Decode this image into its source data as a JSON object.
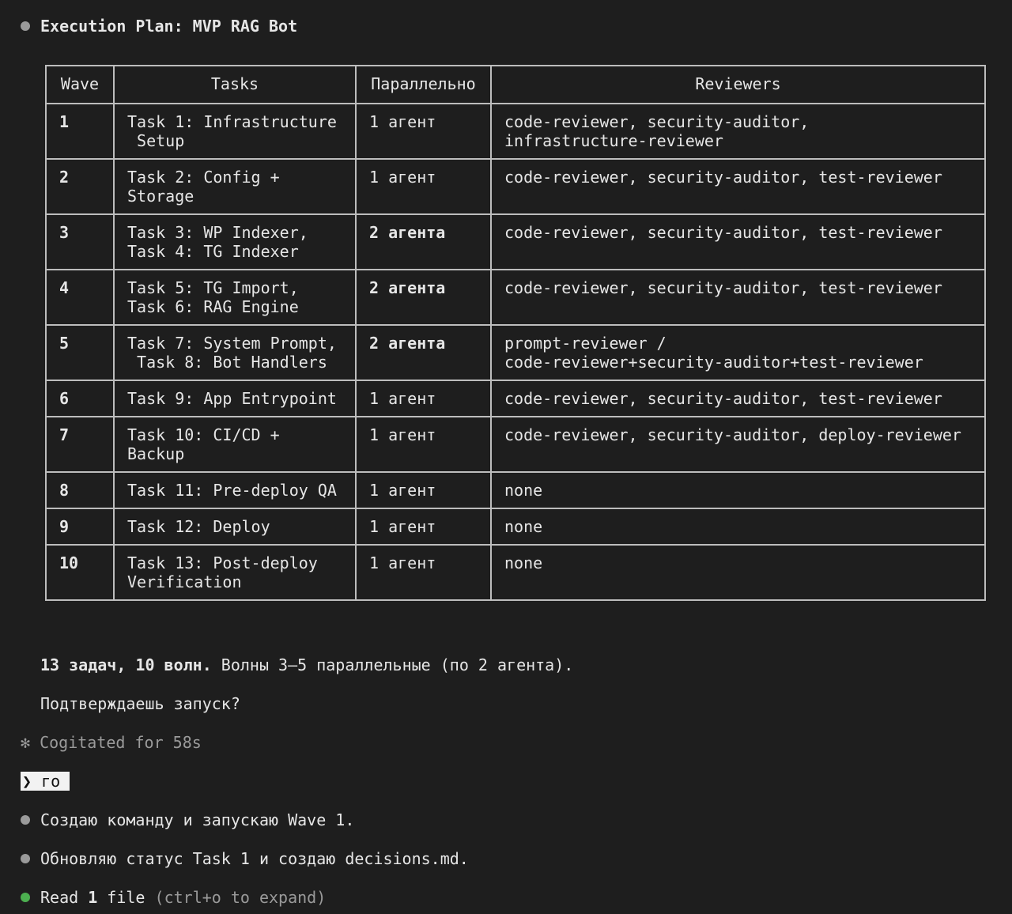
{
  "header": {
    "title": "Execution Plan: MVP RAG Bot"
  },
  "table": {
    "columns": [
      "Wave",
      "Tasks",
      "Параллельно",
      "Reviewers"
    ],
    "rows": [
      {
        "wave": "1",
        "tasks": "Task 1: Infrastructure\n Setup",
        "parallel": "1 агент",
        "reviewers": "code-reviewer, security-auditor,\ninfrastructure-reviewer"
      },
      {
        "wave": "2",
        "tasks": "Task 2: Config +\nStorage",
        "parallel": "1 агент",
        "reviewers": "code-reviewer, security-auditor, test-reviewer"
      },
      {
        "wave": "3",
        "tasks": "Task 3: WP Indexer,\nTask 4: TG Indexer",
        "parallel": "2 агента",
        "reviewers": "code-reviewer, security-auditor, test-reviewer"
      },
      {
        "wave": "4",
        "tasks": "Task 5: TG Import,\nTask 6: RAG Engine",
        "parallel": "2 агента",
        "reviewers": "code-reviewer, security-auditor, test-reviewer"
      },
      {
        "wave": "5",
        "tasks": "Task 7: System Prompt,\n Task 8: Bot Handlers",
        "parallel": "2 агента",
        "reviewers": "prompt-reviewer /\ncode-reviewer+security-auditor+test-reviewer"
      },
      {
        "wave": "6",
        "tasks": "Task 9: App Entrypoint",
        "parallel": "1 агент",
        "reviewers": "code-reviewer, security-auditor, test-reviewer"
      },
      {
        "wave": "7",
        "tasks": "Task 10: CI/CD +\nBackup",
        "parallel": "1 агент",
        "reviewers": "code-reviewer, security-auditor, deploy-reviewer"
      },
      {
        "wave": "8",
        "tasks": "Task 11: Pre-deploy QA",
        "parallel": "1 агент",
        "reviewers": "none"
      },
      {
        "wave": "9",
        "tasks": "Task 12: Deploy",
        "parallel": "1 агент",
        "reviewers": "none"
      },
      {
        "wave": "10",
        "tasks": "Task 13: Post-deploy\nVerification",
        "parallel": "1 агент",
        "reviewers": "none"
      }
    ]
  },
  "summary": {
    "bold": "13 задач, 10 волн.",
    "rest": " Волны 3–5 параллельные (по 2 агента)."
  },
  "confirm": "Подтверждаешь запуск?",
  "cogitated": "✻ Cogitated for 58s",
  "prompt": {
    "symbol": "❯",
    "text": "го"
  },
  "messages": [
    "Создаю команду и запускаю Wave 1.",
    "Обновляю статус Task 1 и создаю decisions.md."
  ],
  "read": {
    "prefix": "Read ",
    "count": "1",
    "word": " file",
    "hint": " (ctrl+o to expand)"
  },
  "colors": {
    "background": "#1e1e1e",
    "text": "#e6e6e6",
    "bullet_gray": "#9a9a9a",
    "bullet_green": "#4caf50"
  }
}
